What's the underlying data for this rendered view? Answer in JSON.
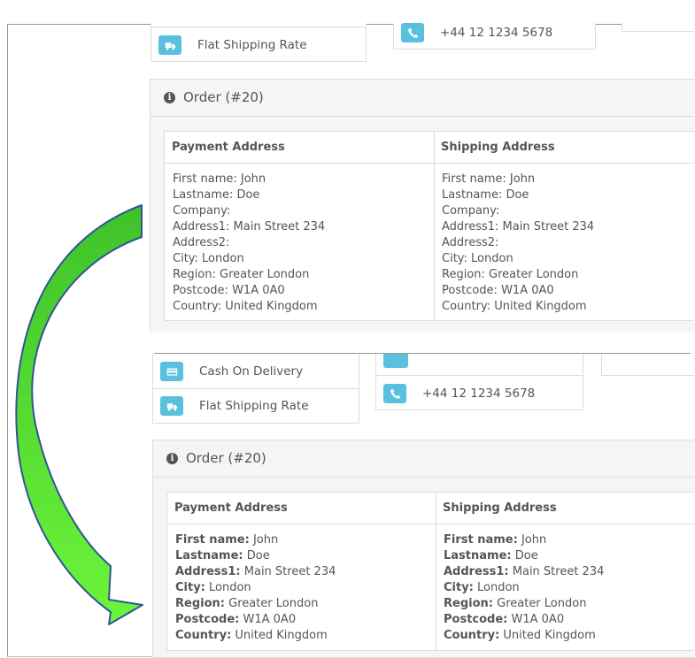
{
  "top": {
    "shipping_method": "Flat Shipping Rate",
    "telephone": "+44 12 1234 5678",
    "order_title": "Order (#20)",
    "table": {
      "payment_header": "Payment Address",
      "shipping_header": "Shipping Address",
      "payment_lines": [
        "First name: John",
        "Lastname: Doe",
        "Company:",
        "Address1: Main Street 234",
        "Address2:",
        "City: London",
        "Region: Greater London",
        "Postcode: W1A 0A0",
        "Country: United Kingdom"
      ],
      "shipping_lines": [
        "First name: John",
        "Lastname: Doe",
        "Company:",
        "Address1: Main Street 234",
        "Address2:",
        "City: London",
        "Region: Greater London",
        "Postcode: W1A 0A0",
        "Country: United Kingdom"
      ]
    }
  },
  "bottom": {
    "payment_method": "Cash On Delivery",
    "shipping_method": "Flat Shipping Rate",
    "telephone": "+44 12 1234 5678",
    "order_title": "Order (#20)",
    "table": {
      "payment_header": "Payment Address",
      "shipping_header": "Shipping Address",
      "payment": [
        {
          "label": "First name:",
          "value": "John"
        },
        {
          "label": "Lastname:",
          "value": "Doe"
        },
        {
          "label": "Address1:",
          "value": "Main Street 234"
        },
        {
          "label": "City:",
          "value": "London"
        },
        {
          "label": "Region:",
          "value": "Greater London"
        },
        {
          "label": "Postcode:",
          "value": "W1A 0A0"
        },
        {
          "label": "Country:",
          "value": "United Kingdom"
        }
      ],
      "shipping": [
        {
          "label": "First name:",
          "value": "John"
        },
        {
          "label": "Lastname:",
          "value": "Doe"
        },
        {
          "label": "Address1:",
          "value": "Main Street 234"
        },
        {
          "label": "City:",
          "value": "London"
        },
        {
          "label": "Region:",
          "value": "Greater London"
        },
        {
          "label": "Postcode:",
          "value": "W1A 0A0"
        },
        {
          "label": "Country:",
          "value": "United Kingdom"
        }
      ]
    }
  },
  "colors": {
    "icon_button": "#5bc0de",
    "arrow_fill_top": "#3fc22a",
    "arrow_fill_bottom": "#6cf53a",
    "arrow_stroke": "#2f5597"
  },
  "icons": {
    "truck": "truck-icon",
    "phone": "phone-icon",
    "card": "credit-card-icon",
    "info": "info-icon"
  }
}
